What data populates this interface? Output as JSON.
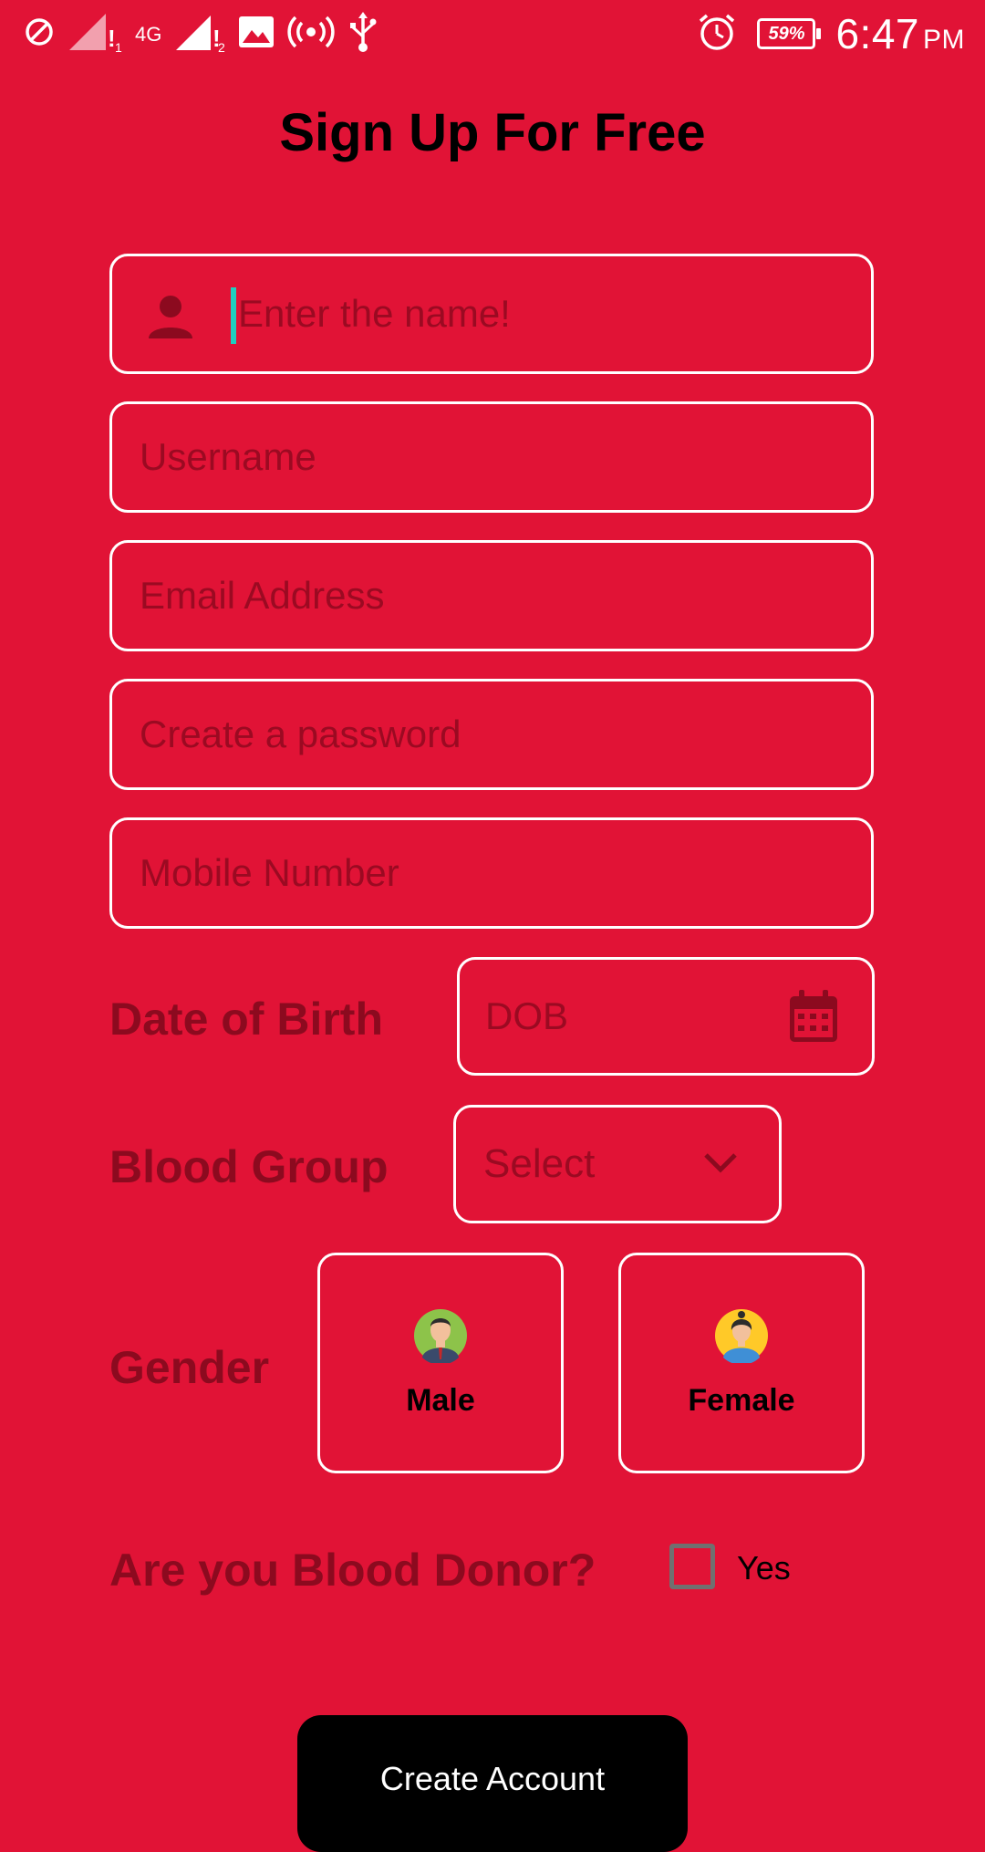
{
  "status_bar": {
    "time": "6:47",
    "ampm": "PM",
    "battery": "59%",
    "network": "4G",
    "icons": [
      "do-not-disturb-icon",
      "signal-icon",
      "image-icon",
      "hotspot-icon",
      "usb-icon",
      "alarm-icon",
      "battery-icon"
    ]
  },
  "title": "Sign Up For Free",
  "form": {
    "name_placeholder": "Enter the name!",
    "username_placeholder": "Username",
    "email_placeholder": "Email Address",
    "password_placeholder": "Create a password",
    "mobile_placeholder": "Mobile Number",
    "dob_label": "Date of Birth",
    "dob_placeholder": "DOB",
    "blood_label": "Blood Group",
    "blood_placeholder": "Select",
    "gender_label": "Gender",
    "gender_options": [
      "Male",
      "Female"
    ],
    "donor_label": "Are you Blood Donor?",
    "donor_option": "Yes",
    "submit_label": "Create Account"
  },
  "colors": {
    "background": "#E11336",
    "placeholder": "#9B0A22",
    "label": "#8C0A1F",
    "button": "#000000"
  }
}
